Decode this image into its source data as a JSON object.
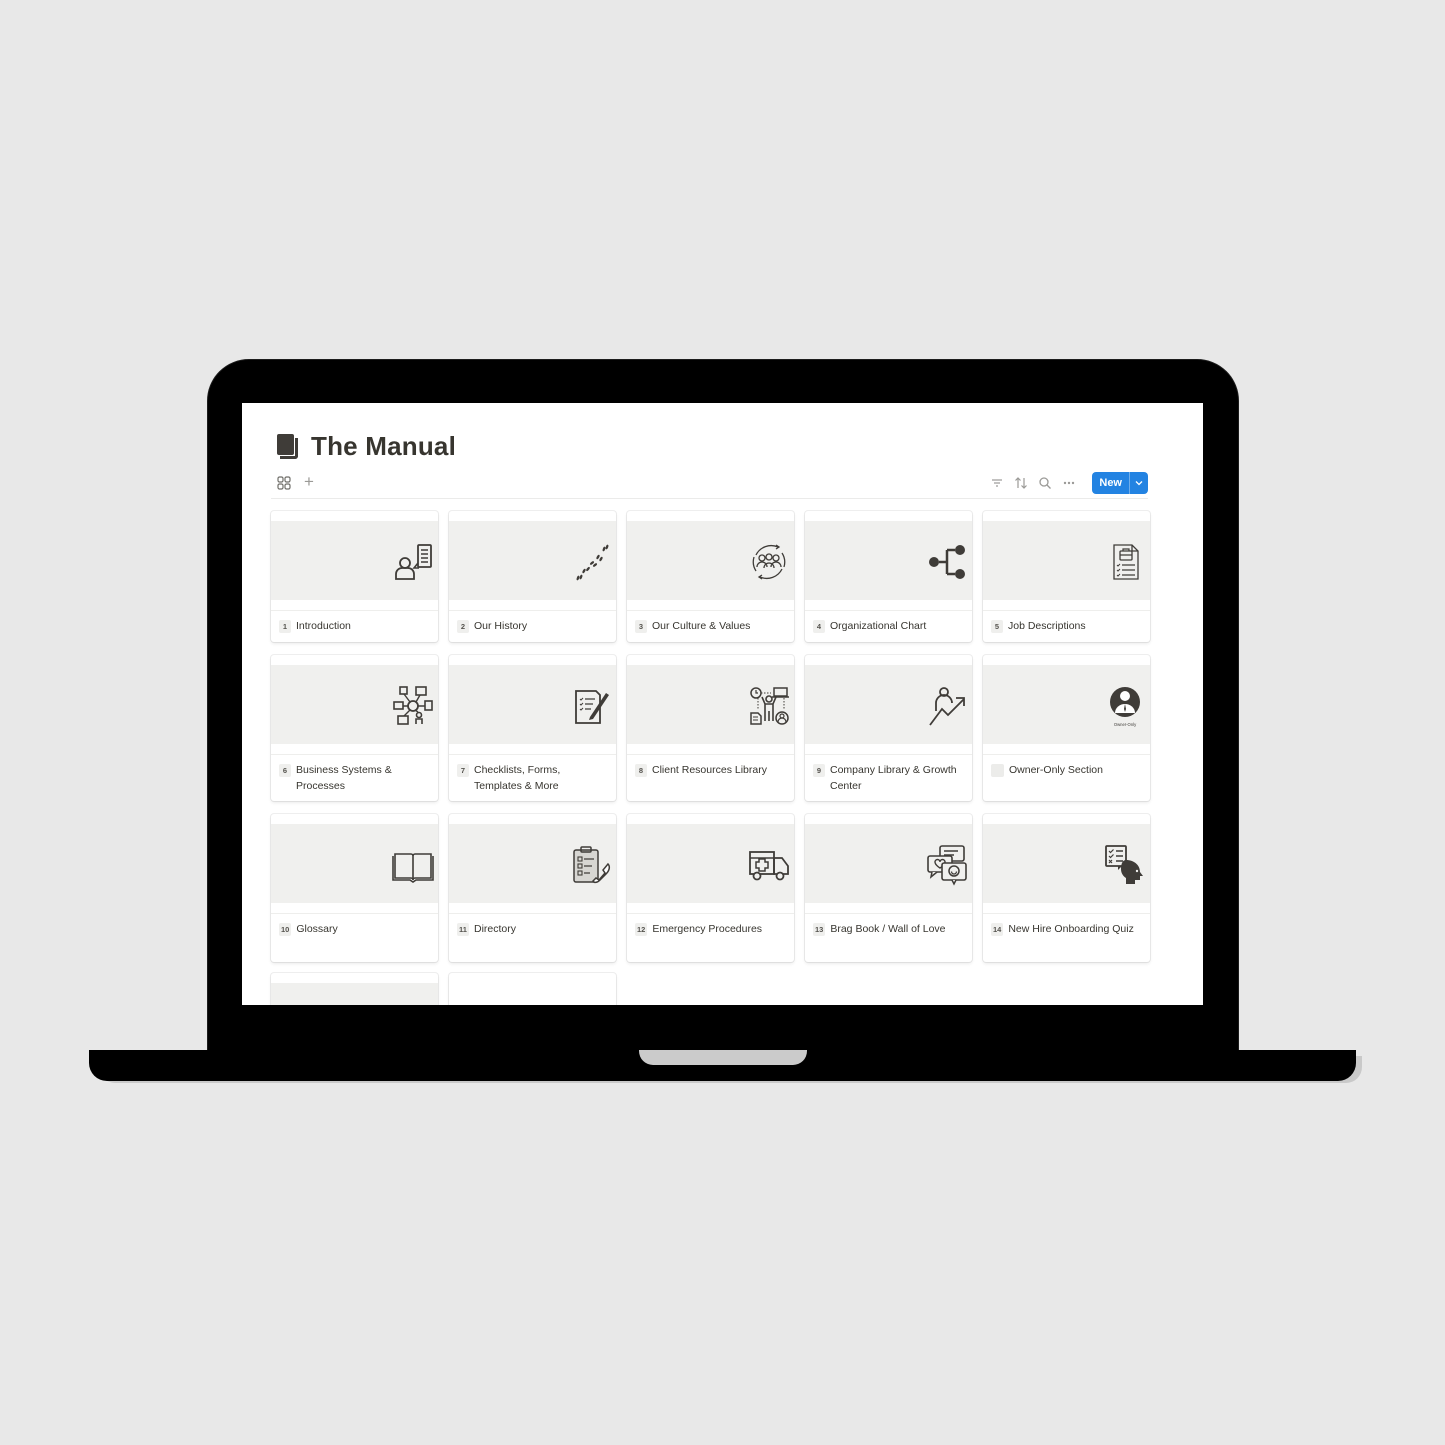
{
  "page": {
    "title": "The Manual",
    "title_icon": "book-icon"
  },
  "toolbar": {
    "view_icon": "gallery-view-icon",
    "add_view_label": "+",
    "filter_icon": "filter-icon",
    "sort_icon": "sort-icon",
    "search_icon": "search-icon",
    "more_icon": "more-icon",
    "new_label": "New",
    "new_dropdown_icon": "chevron-down-icon"
  },
  "colors": {
    "accent": "#2383e2",
    "text": "#37352f",
    "cover_bg": "#f0f0ee",
    "icon": "#3f3c38"
  },
  "cards": [
    {
      "num": "1",
      "title": "Introduction",
      "icon": "person-document-icon"
    },
    {
      "num": "2",
      "title": "Our History",
      "icon": "footprints-icon"
    },
    {
      "num": "3",
      "title": "Our Culture & Values",
      "icon": "team-cycle-icon"
    },
    {
      "num": "4",
      "title": "Organizational Chart",
      "icon": "org-chart-icon"
    },
    {
      "num": "5",
      "title": "Job Descriptions",
      "icon": "job-document-icon"
    },
    {
      "num": "6",
      "title": "Business Systems & Processes",
      "icon": "business-network-icon"
    },
    {
      "num": "7",
      "title": "Checklists, Forms, Templates & More",
      "icon": "checklist-pen-icon"
    },
    {
      "num": "8",
      "title": "Client Resources Library",
      "icon": "client-resources-icon"
    },
    {
      "num": "9",
      "title": "Company Library & Growth Center",
      "icon": "growth-person-icon"
    },
    {
      "num": "",
      "title": "Owner-Only Section",
      "icon": "owner-only-icon",
      "icon_caption": "Owner-Only"
    },
    {
      "num": "10",
      "title": "Glossary",
      "icon": "open-book-icon"
    },
    {
      "num": "11",
      "title": "Directory",
      "icon": "clipboard-phone-icon"
    },
    {
      "num": "12",
      "title": "Emergency Procedures",
      "icon": "ambulance-icon"
    },
    {
      "num": "13",
      "title": "Brag Book / Wall of Love",
      "icon": "chat-bubbles-heart-icon"
    },
    {
      "num": "14",
      "title": "New Hire Onboarding Quiz",
      "icon": "quiz-head-icon"
    },
    {
      "num": "",
      "title": "",
      "icon": ""
    },
    {
      "num": "",
      "title": "",
      "icon": ""
    }
  ]
}
